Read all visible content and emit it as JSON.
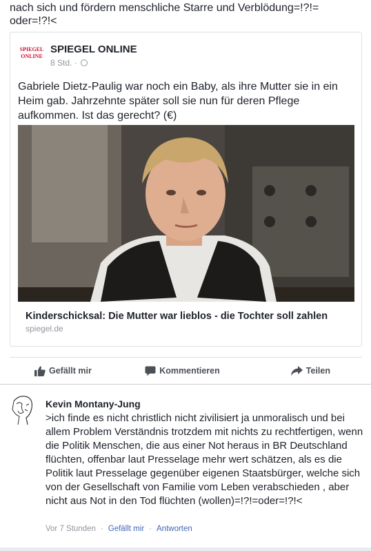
{
  "post": {
    "text": "nach sich und fördern  menschliche Starre   und Verblödung=!?!=\noder=!?!<"
  },
  "shared": {
    "page_logo_line1": "SPIEGEL",
    "page_logo_line2": "ONLINE",
    "page_name": "SPIEGEL ONLINE",
    "time": "8 Std. ·",
    "text": "Gabriele Dietz-Paulig war noch ein Baby, als ihre Mutter sie in ein Heim gab. Jahrzehnte später soll sie nun für deren Pflege aufkommen. Ist das gerecht? (€)",
    "link_title": "Kinderschicksal: Die Mutter war lieblos - die Tochter soll zahlen",
    "link_domain": "spiegel.de"
  },
  "actions": {
    "like": "Gefällt mir",
    "comment": "Kommentieren",
    "share": "Teilen"
  },
  "comment": {
    "author": "Kevin Montany-Jung",
    "text": ">ich finde es nicht christlich nicht zivilisiert ja unmoralisch und bei allem Problem Verständnis trotzdem mit nichts zu rechtfertigen, wenn die Politik Menschen, die aus einer Not heraus  in BR Deutschland  flüchten, offenbar laut Presselage mehr wert schätzen, als es die Politik laut Presselage gegenüber eigenen Staatsbürger, welche sich von der Gesellschaft von Familie vom Leben verabschieden , aber nicht  aus Not in den Tod flüchten (wollen)=!?!=oder=!?!<",
    "time": "Vor 7 Stunden",
    "like": "Gefällt mir",
    "reply": "Antworten"
  },
  "colors": {
    "link_blue": "#4267b2",
    "meta_gray": "#90949c",
    "spiegel_red": "#c8102e"
  }
}
